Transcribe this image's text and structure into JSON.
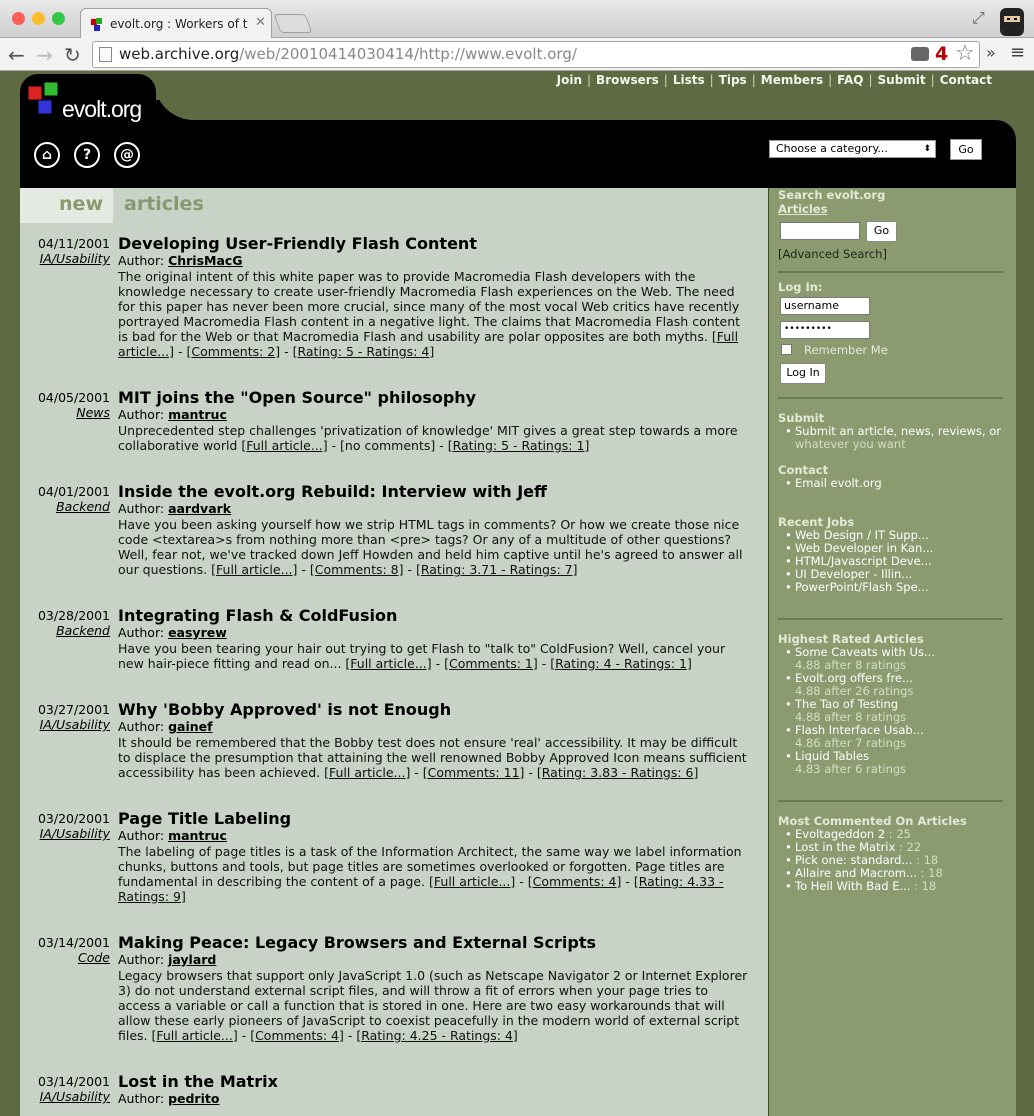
{
  "browser": {
    "tab_title": "evolt.org : Workers of the W",
    "url_host": "web.archive.org",
    "url_path": "/web/20010414030414/http://www.evolt.org/",
    "badge": "4"
  },
  "site": {
    "logo_text": "evolt.org",
    "top_links": [
      "Join",
      "Browsers",
      "Lists",
      "Tips",
      "Members",
      "FAQ",
      "Submit",
      "Contact"
    ],
    "category_select": "Choose a category...",
    "category_go": "Go",
    "section_new": "new",
    "section_articles": "articles",
    "colors": {
      "olive": "#5e6b42",
      "main_bg": "#c8d2c6",
      "sidebar_bg": "#8c9a70"
    }
  },
  "articles": [
    {
      "date": "04/11/2001",
      "category": "IA/Usability",
      "title": "Developing User-Friendly Flash Content",
      "author_label": "Author:",
      "author": "ChrisMacG",
      "body": "The original intent of this white paper was to provide Macromedia Flash developers with the knowledge necessary to create user-friendly Macromedia Flash experiences on the Web. The need for this paper has never been more crucial, since many of the most vocal Web critics have recently portrayed Macromedia Flash content in a negative light. The claims that Macromedia Flash content is bad for the Web or that Macromedia Flash and usability are polar opposites are both myths.",
      "full": "[Full article...]",
      "comments": "[Comments: 2]",
      "rating": "[Rating: 5 - Ratings: 4]"
    },
    {
      "date": "04/05/2001",
      "category": "News",
      "title": "MIT joins the \"Open Source\" philosophy",
      "author_label": "Author:",
      "author": "mantruc",
      "body": "Unprecedented step challenges 'privatization of knowledge' MIT gives a great step towards a more collaborative world",
      "full": "[Full article...]",
      "comments": "[no comments]",
      "rating": "[Rating: 5 - Ratings: 1]"
    },
    {
      "date": "04/01/2001",
      "category": "Backend",
      "title": "Inside the evolt.org Rebuild: Interview with Jeff",
      "author_label": "Author:",
      "author": "aardvark",
      "body": "Have you been asking yourself how we strip HTML tags in comments? Or how we create those nice code <textarea>s from nothing more than <pre> tags? Or any of a multitude of other questions? Well, fear not, we've tracked down Jeff Howden and held him captive until he's agreed to answer all our questions.",
      "full": "[Full article...]",
      "comments": "[Comments: 8]",
      "rating": "[Rating: 3.71 - Ratings: 7]"
    },
    {
      "date": "03/28/2001",
      "category": "Backend",
      "title": "Integrating Flash & ColdFusion",
      "author_label": "Author:",
      "author": "easyrew",
      "body": "Have you been tearing your hair out trying to get Flash to \"talk to\" ColdFusion? Well, cancel your new hair-piece fitting and read on...",
      "full": "[Full article...]",
      "comments": "[Comments: 1]",
      "rating": "[Rating: 4 - Ratings: 1]"
    },
    {
      "date": "03/27/2001",
      "category": "IA/Usability",
      "title": "Why 'Bobby Approved' is not Enough",
      "author_label": "Author:",
      "author": "gainef",
      "body": "It should be remembered that the Bobby test does not ensure 'real' accessibility. It may be difficult to displace the presumption that attaining the well renowned Bobby Approved Icon means sufficient accessibility has been achieved.",
      "full": "[Full article...]",
      "comments": "[Comments: 11]",
      "rating": "[Rating: 3.83 - Ratings: 6]"
    },
    {
      "date": "03/20/2001",
      "category": "IA/Usability",
      "title": "Page Title Labeling",
      "author_label": "Author:",
      "author": "mantruc",
      "body": "The labeling of page titles is a task of the Information Architect, the same way we label information chunks, buttons and tools, but page titles are sometimes overlooked or forgotten. Page titles are fundamental in describing the content of a page.",
      "full": "[Full article...]",
      "comments": "[Comments: 4]",
      "rating": "[Rating: 4.33 - Ratings: 9]"
    },
    {
      "date": "03/14/2001",
      "category": "Code",
      "title": "Making Peace: Legacy Browsers and External Scripts",
      "author_label": "Author:",
      "author": "jaylard",
      "body": "Legacy browsers that support only JavaScript 1.0 (such as Netscape Navigator 2 or Internet Explorer 3) do not understand external script files, and will throw a fit of errors when your page tries to access a variable or call a function that is stored in one. Here are two easy workarounds that will allow these early pioneers of JavaScript to coexist peacefully in the modern world of external script files.",
      "full": "[Full article...]",
      "comments": "[Comments: 4]",
      "rating": "[Rating: 4.25 - Ratings: 4]"
    },
    {
      "date": "03/14/2001",
      "category": "IA/Usability",
      "title": "Lost in the Matrix",
      "author_label": "Author:",
      "author": "pedrito",
      "body": "",
      "full": "",
      "comments": "",
      "rating": ""
    }
  ],
  "sidebar": {
    "search_title": "Search evolt.org",
    "search_sub": "Articles",
    "search_go": "Go",
    "advanced": "[Advanced Search]",
    "login_title": "Log In:",
    "username": "username",
    "password": "•••••••••",
    "remember": "Remember Me",
    "login_btn": "Log In",
    "submit_title": "Submit",
    "submit_items": [
      "Submit an article, news, reviews, or",
      "whatever you want"
    ],
    "contact_title": "Contact",
    "contact_items": [
      "Email evolt.org"
    ],
    "jobs_title": "Recent Jobs",
    "jobs": [
      "Web Design / IT Supp...",
      "Web Developer in Kan...",
      "HTML/Javascript Deve...",
      "UI Developer - Illin...",
      "PowerPoint/Flash Spe..."
    ],
    "rated_title": "Highest Rated Articles",
    "rated": [
      {
        "name": "Some Caveats with Us...",
        "score": "4.88 after 8 ratings"
      },
      {
        "name": "Evolt.org offers fre...",
        "score": "4.88 after 26 ratings"
      },
      {
        "name": "The Tao of Testing",
        "score": "4.88 after 8 ratings"
      },
      {
        "name": "Flash Interface Usab...",
        "score": "4.86 after 7 ratings"
      },
      {
        "name": "Liquid Tables",
        "score": "4.83 after 6 ratings"
      }
    ],
    "commented_title": "Most Commented On Articles",
    "commented": [
      {
        "name": "Evoltageddon 2",
        "count": " : 25"
      },
      {
        "name": "Lost in the Matrix",
        "count": " : 22"
      },
      {
        "name": "Pick one: standard...",
        "count": " : 18"
      },
      {
        "name": "Allaire and Macrom...",
        "count": " : 18"
      },
      {
        "name": "To Hell With Bad E...",
        "count": " : 18"
      }
    ]
  }
}
